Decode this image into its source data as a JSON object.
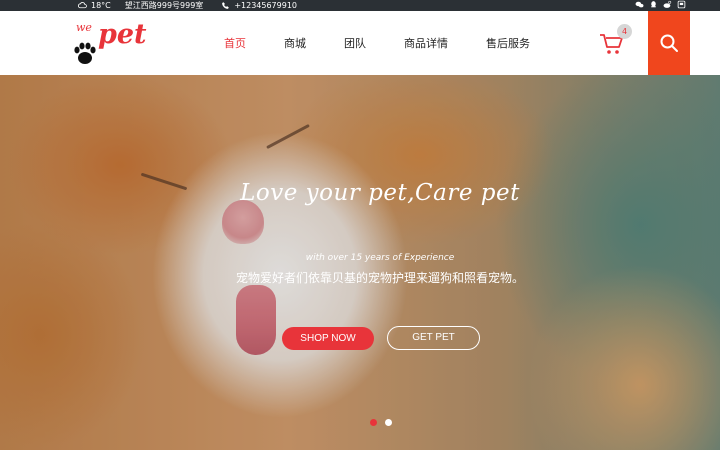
{
  "topbar": {
    "weather_icon": "cloud-icon",
    "temperature": "18°C",
    "address": "望江西路999号999室",
    "phone_icon": "phone-icon",
    "phone": "+12345679910",
    "social_icons": [
      "wechat-icon",
      "qq-icon",
      "weibo-icon",
      "douban-icon"
    ]
  },
  "header": {
    "logo": {
      "we": "we",
      "pet": "pet"
    },
    "nav": [
      {
        "label": "首页",
        "active": true
      },
      {
        "label": "商城",
        "active": false
      },
      {
        "label": "团队",
        "active": false
      },
      {
        "label": "商品详情",
        "active": false
      },
      {
        "label": "售后服务",
        "active": false
      }
    ],
    "cart_count": "4",
    "accent_color": "#e8343a",
    "search_bg": "#f0461d"
  },
  "hero": {
    "title": "Love your pet,Care pet",
    "subtitle": "with over 15 years of Experience",
    "description": "宠物爱好者们依靠贝基的宠物护理来遛狗和照看宠物。",
    "shop_button": "SHOP NOW",
    "get_button": "GET PET",
    "slides_count": 2,
    "active_slide": 1
  }
}
